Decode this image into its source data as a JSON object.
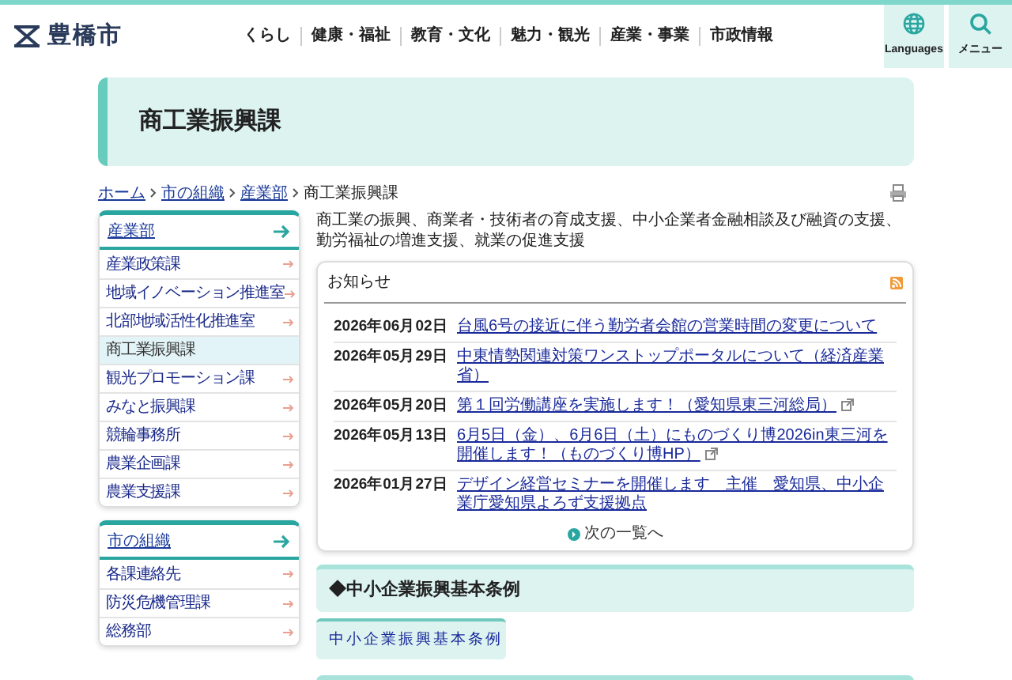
{
  "header": {
    "logo_text": "豊橋市",
    "nav": [
      "くらし",
      "健康・福祉",
      "教育・文化",
      "魅力・観光",
      "産業・事業",
      "市政情報"
    ],
    "buttons": [
      {
        "label": "Languages",
        "kind": "globe"
      },
      {
        "label": "メニュー",
        "kind": "search"
      }
    ]
  },
  "page_title": "商工業振興課",
  "breadcrumb": [
    {
      "label": "ホーム",
      "link": true
    },
    {
      "label": "市の組織",
      "link": true
    },
    {
      "label": "産業部",
      "link": true
    },
    {
      "label": "商工業振興課",
      "link": false
    }
  ],
  "sidebar": [
    {
      "heading": "産業部",
      "items": [
        {
          "label": "産業政策課",
          "selected": false
        },
        {
          "label": "地域イノベーション推進室",
          "selected": false
        },
        {
          "label": "北部地域活性化推進室",
          "selected": false
        },
        {
          "label": "商工業振興課",
          "selected": true
        },
        {
          "label": "観光プロモーション課",
          "selected": false
        },
        {
          "label": "みなと振興課",
          "selected": false
        },
        {
          "label": "競輪事務所",
          "selected": false
        },
        {
          "label": "農業企画課",
          "selected": false
        },
        {
          "label": "農業支援課",
          "selected": false
        }
      ]
    },
    {
      "heading": "市の組織",
      "items": [
        {
          "label": "各課連絡先",
          "selected": false
        },
        {
          "label": "防災危機管理課",
          "selected": false
        },
        {
          "label": "総務部",
          "selected": false
        }
      ]
    }
  ],
  "description": "商工業の振興、商業者・技術者の育成支援、中小企業者金融相談及び融資の支援、勤労福祉の増進支援、就業の促進支援",
  "news": {
    "title": "お知らせ",
    "items": [
      {
        "date": "2026年06月02日",
        "title": "台風6号の接近に伴う勤労者会館の営業時間の変更について",
        "external": false
      },
      {
        "date": "2026年05月29日",
        "title": "中東情勢関連対策ワンストップポータルについて（経済産業省）",
        "external": false
      },
      {
        "date": "2026年05月20日",
        "title": "第１回労働講座を実施します！（愛知県東三河総局）",
        "external": true
      },
      {
        "date": "2026年05月13日",
        "title": "6月5日（金）、6月6日（土）にものづくり博2026in東三河を開催します！（ものづくり博HP）",
        "external": true
      },
      {
        "date": "2026年01月27日",
        "title": "デザイン経営セミナーを開催します　主催　愛知県、中小企業庁愛知県よろず支援拠点",
        "external": false
      }
    ],
    "more": "次の一覧へ"
  },
  "sections": [
    {
      "heading": "◆中小企業振興基本条例",
      "links": [
        "中小企業振興基本条例"
      ]
    }
  ]
}
